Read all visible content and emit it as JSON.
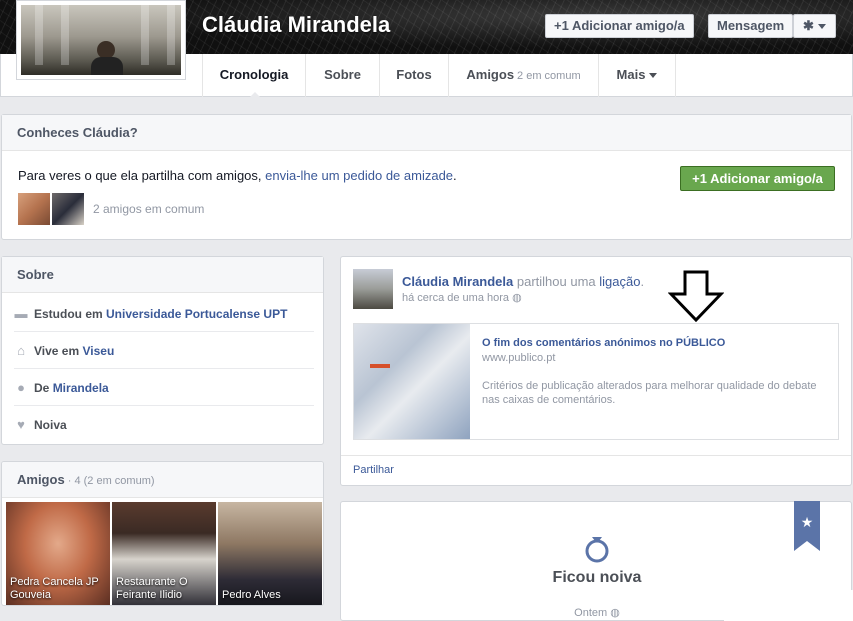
{
  "profile": {
    "name": "Cláudia Mirandela",
    "add_friend_label": "+1 Adicionar amigo/a",
    "message_label": "Mensagem",
    "gear_icon": "gear-icon"
  },
  "tabs": {
    "timeline": "Cronologia",
    "about": "Sobre",
    "photos": "Fotos",
    "friends": "Amigos",
    "friends_sub": "2 em comum",
    "more": "Mais"
  },
  "know": {
    "title": "Conheces Cláudia?",
    "text_before": "Para veres o que ela partilha com amigos,",
    "text_link": "envia-lhe um pedido de amizade",
    "text_after": ".",
    "add_label": "+1 Adicionar amigo/a",
    "mutual": "2 amigos em comum"
  },
  "about": {
    "title": "Sobre",
    "study_prefix": "Estudou em",
    "study_value": "Universidade Portucalense UPT",
    "lives_prefix": "Vive em",
    "lives_value": "Viseu",
    "from_prefix": "De",
    "from_value": "Mirandela",
    "relationship": "Noiva"
  },
  "friends": {
    "title": "Amigos",
    "count": " · 4 (2 em comum)",
    "tiles": [
      {
        "name": "Pedra Cancela JP Gouveia"
      },
      {
        "name": "Restaurante O Feirante Ilidio"
      },
      {
        "name": "Pedro Alves"
      }
    ]
  },
  "post": {
    "author": "Cláudia Mirandela",
    "action": "partilhou uma",
    "link_word": "ligação",
    "after": ".",
    "time": "há cerca de uma hora",
    "link_title": "O fim dos comentários anónimos no PÚBLICO",
    "link_url": "www.publico.pt",
    "link_desc": "Critérios de publicação alterados para melhorar qualidade do debate nas caixas de comentários.",
    "share": "Partilhar"
  },
  "event": {
    "title": "Ficou noiva",
    "time": "Ontem"
  },
  "colors": {
    "brand": "#3b5998",
    "add_green": "#69a74e",
    "ribbon": "#5b74a8"
  }
}
